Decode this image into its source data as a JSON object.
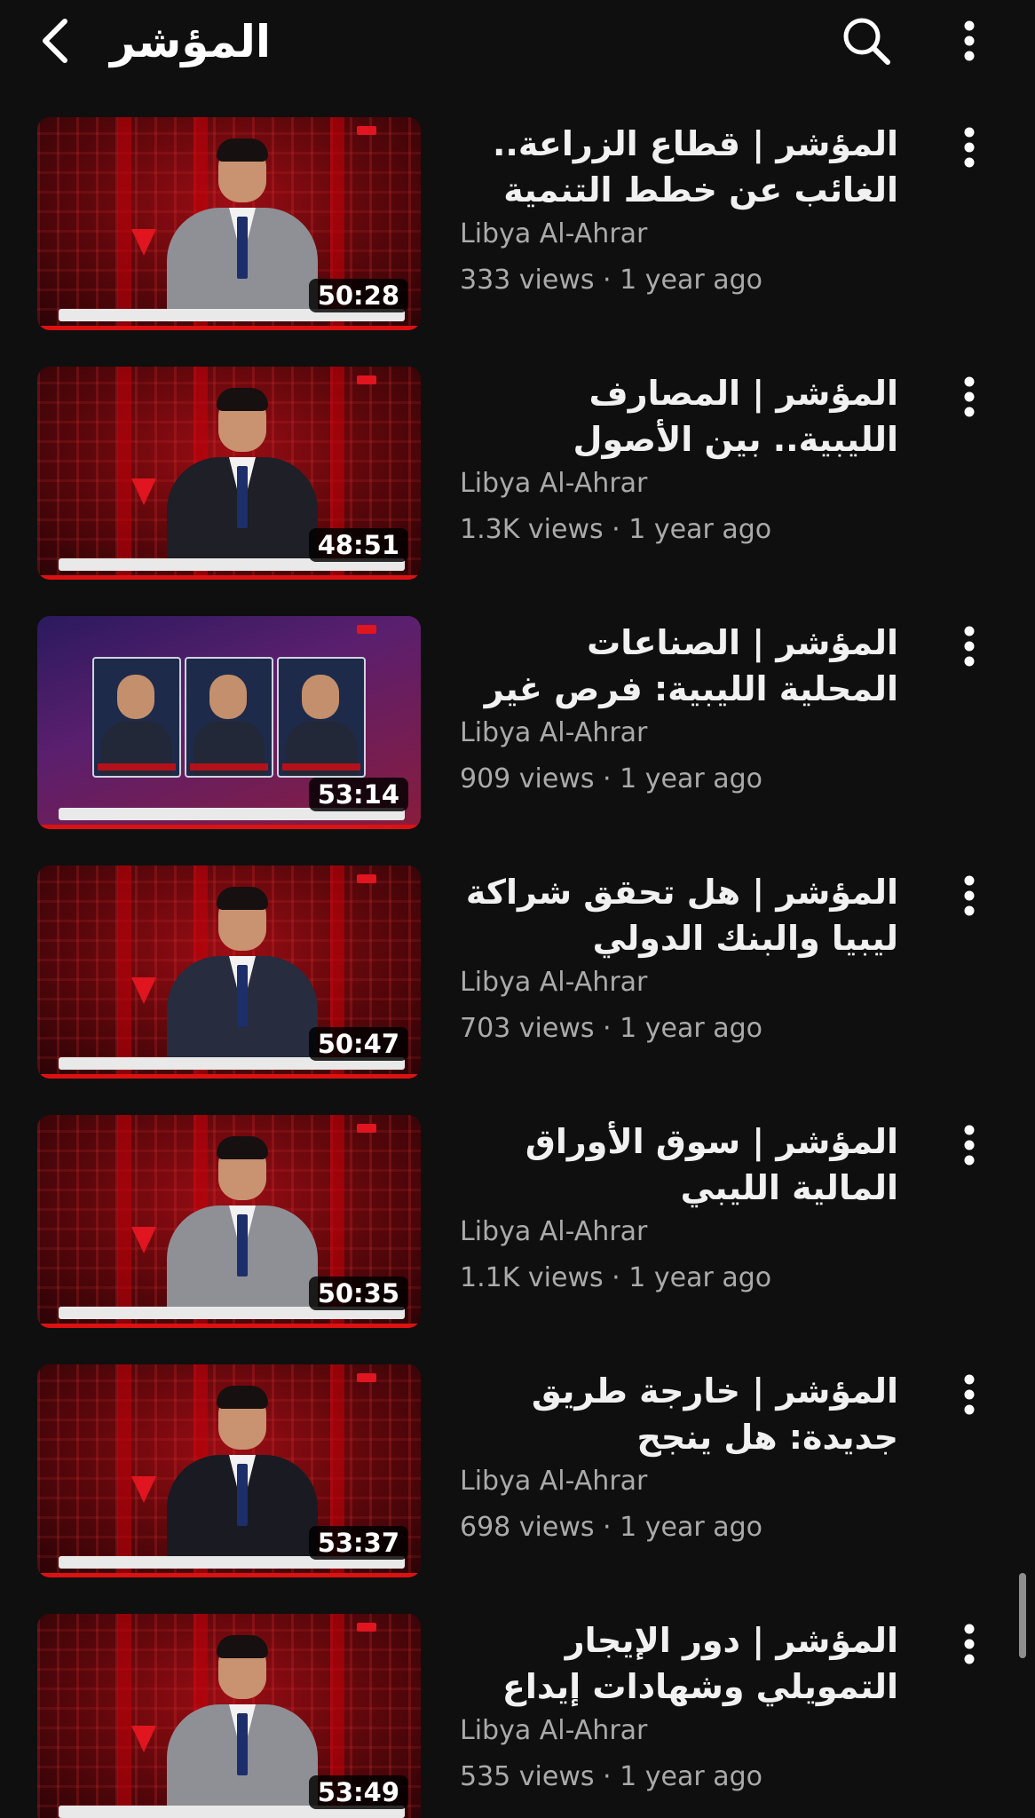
{
  "header": {
    "title": "المؤشر",
    "back_icon": "chevron-left-icon",
    "search_icon": "search-icon",
    "more_icon": "more-vertical-icon"
  },
  "videos": [
    {
      "title": "المؤشر | قطاع الزراعة.. الغائب عن خطط التنمية ال...",
      "channel": "Libya Al-Ahrar",
      "views": "333 views",
      "age": "1 year ago",
      "duration": "50:28"
    },
    {
      "title": "المؤشر | المصارف الليبية.. بين الأصول المتضخمة وال...",
      "channel": "Libya Al-Ahrar",
      "views": "1.3K views",
      "age": "1 year ago",
      "duration": "48:51"
    },
    {
      "title": "المؤشر | الصناعات المحلية الليبية: فرص غير مستغلة",
      "channel": "Libya Al-Ahrar",
      "views": "909 views",
      "age": "1 year ago",
      "duration": "53:14"
    },
    {
      "title": "المؤشر | هل تحقق شراكة ليبيا والبنك الدولي طموحا...",
      "channel": "Libya Al-Ahrar",
      "views": "703 views",
      "age": "1 year ago",
      "duration": "50:47"
    },
    {
      "title": "المؤشر | سوق الأوراق المالية الليبي",
      "channel": "Libya Al-Ahrar",
      "views": "1.1K views",
      "age": "1 year ago",
      "duration": "50:35"
    },
    {
      "title": "المؤشر | خارجة طريق جديدة: هل ينجح المركزي...",
      "channel": "Libya Al-Ahrar",
      "views": "698 views",
      "age": "1 year ago",
      "duration": "53:37"
    },
    {
      "title": "المؤشر | دور الإيجار التمويلي وشهادات إيداع المضاربة ف...",
      "channel": "Libya Al-Ahrar",
      "views": "535 views",
      "age": "1 year ago",
      "duration": "53:49"
    }
  ],
  "separator": " · ",
  "colors": {
    "background": "#0f0f0f",
    "text_primary": "#f1f1f1",
    "text_secondary": "#aaaaaa",
    "thumbnail_red": "#9b0d14"
  }
}
